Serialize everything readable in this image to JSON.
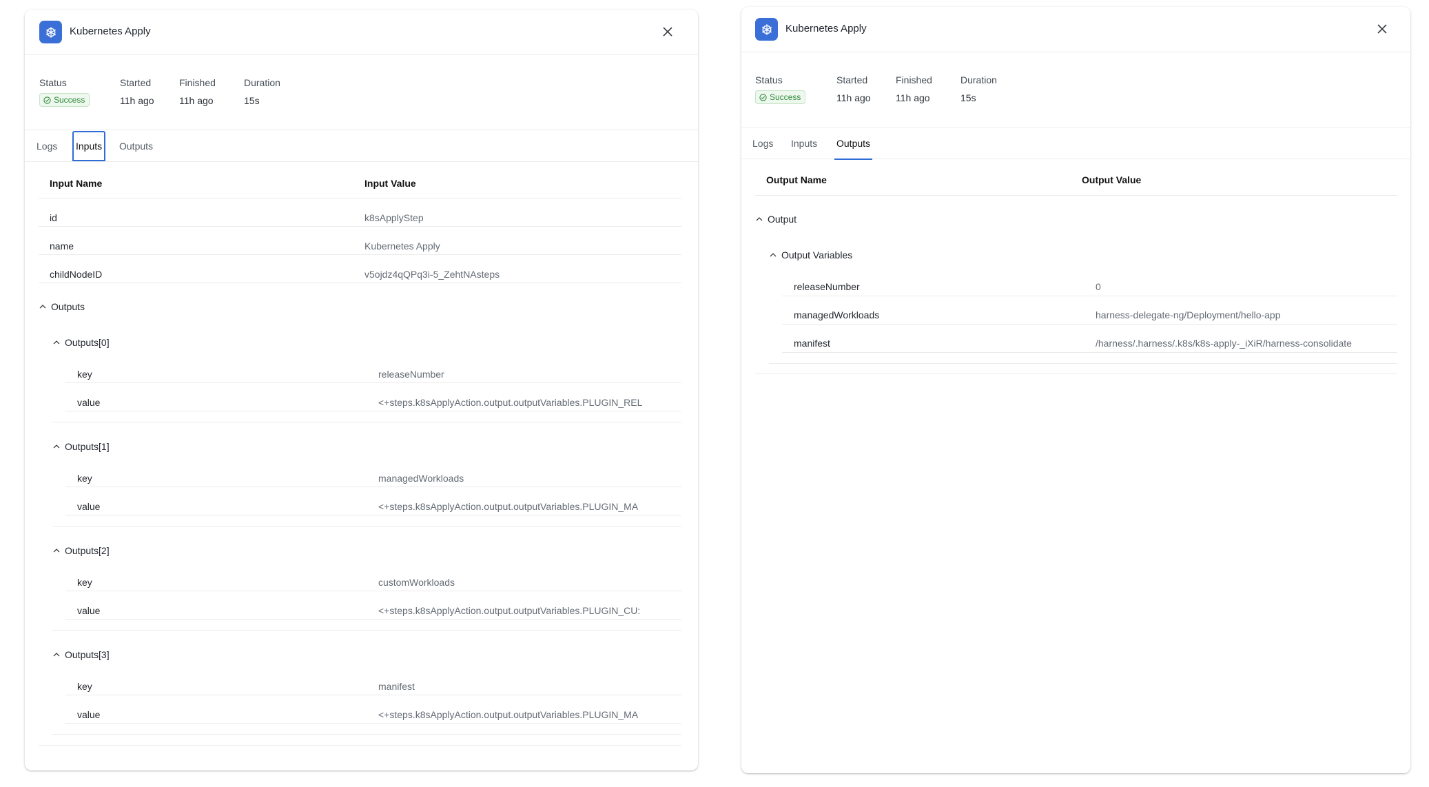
{
  "left": {
    "title": "Kubernetes Apply",
    "meta": {
      "status_label": "Status",
      "status_value": "Success",
      "started_label": "Started",
      "started_value": "11h ago",
      "finished_label": "Finished",
      "finished_value": "11h ago",
      "duration_label": "Duration",
      "duration_value": "15s"
    },
    "tabs": [
      "Logs",
      "Inputs",
      "Outputs"
    ],
    "active_tab": "Inputs",
    "table": {
      "col1": "Input Name",
      "col2": "Input Value",
      "rows": [
        {
          "key": "id",
          "value": "k8sApplyStep"
        },
        {
          "key": "name",
          "value": "Kubernetes Apply"
        },
        {
          "key": "childNodeID",
          "value": "v5ojdz4qQPq3i-5_ZehtNAsteps"
        }
      ],
      "outputs_group": "Outputs",
      "subgroups": [
        {
          "label": "Outputs[0]",
          "key_label": "key",
          "key_value": "releaseNumber",
          "value_label": "value",
          "value_value": "<+steps.k8sApplyAction.output.outputVariables.PLUGIN_REL"
        },
        {
          "label": "Outputs[1]",
          "key_label": "key",
          "key_value": "managedWorkloads",
          "value_label": "value",
          "value_value": "<+steps.k8sApplyAction.output.outputVariables.PLUGIN_MA"
        },
        {
          "label": "Outputs[2]",
          "key_label": "key",
          "key_value": "customWorkloads",
          "value_label": "value",
          "value_value": "<+steps.k8sApplyAction.output.outputVariables.PLUGIN_CU:"
        },
        {
          "label": "Outputs[3]",
          "key_label": "key",
          "key_value": "manifest",
          "value_label": "value",
          "value_value": "<+steps.k8sApplyAction.output.outputVariables.PLUGIN_MA"
        }
      ]
    }
  },
  "right": {
    "title": "Kubernetes Apply",
    "meta": {
      "status_label": "Status",
      "status_value": "Success",
      "started_label": "Started",
      "started_value": "11h ago",
      "finished_label": "Finished",
      "finished_value": "11h ago",
      "duration_label": "Duration",
      "duration_value": "15s"
    },
    "tabs": [
      "Logs",
      "Inputs",
      "Outputs"
    ],
    "active_tab": "Outputs",
    "table": {
      "col1": "Output Name",
      "col2": "Output Value",
      "group": "Output",
      "subgroup": "Output Variables",
      "rows": [
        {
          "key": "releaseNumber",
          "value": "0"
        },
        {
          "key": "managedWorkloads",
          "value": "harness-delegate-ng/Deployment/hello-app"
        },
        {
          "key": "manifest",
          "value": "/harness/.harness/.k8s/k8s-apply-_iXiR/harness-consolidate"
        }
      ]
    }
  },
  "colors": {
    "accent": "#2f6cd6",
    "icon_bg": "#3a6fd8",
    "success": "#2f8a3a"
  }
}
